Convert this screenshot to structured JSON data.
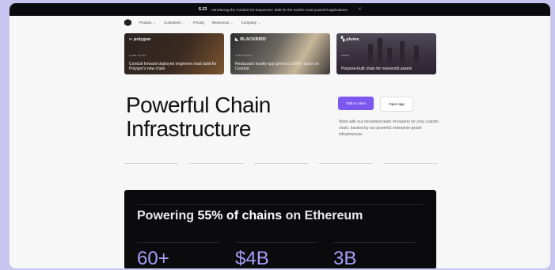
{
  "announcement": {
    "badge": "S-23",
    "text": "Introducing the Conduit G3 Sequencer: Built for the world's most powerful applications",
    "close": "×"
  },
  "nav": {
    "items": [
      {
        "label": "Product",
        "chevron": "⌄"
      },
      {
        "label": "Customers",
        "chevron": "⌄"
      },
      {
        "label": "Pricing",
        "chevron": ""
      },
      {
        "label": "Resources",
        "chevron": "⌄"
      },
      {
        "label": "Company",
        "chevron": "⌄"
      }
    ]
  },
  "cards": [
    {
      "brand": "polygon",
      "category": "CASE STUDY",
      "title": "Conduit forward-deployed engineers lead build for Polygon's new chain"
    },
    {
      "brand": "BLACKBIRD",
      "category": "CASE STUDY",
      "title": "Restaurant loyalty app grows to 100k+ users on Conduit"
    },
    {
      "brand": "plume",
      "category": "NEWS",
      "title": "Purpose-built chain for real-world assets"
    }
  ],
  "hero": {
    "title_line1": "Powerful Chain",
    "title_line2": "Infrastructure",
    "primary_cta": "Talk to sales",
    "secondary_cta": "Open app",
    "description": "Work with our renowned team of experts for your custom chain, backed by our powerful enterprise-grade infrastructure."
  },
  "stats_section": {
    "headline_pre": "Powering ",
    "headline_bold": "55% of chains",
    "headline_post": " on Ethereum",
    "stats": [
      "60+",
      "$4B",
      "3B"
    ]
  },
  "colors": {
    "accent": "#7c58f0",
    "stat_color": "#a89cf6",
    "frame_bg": "#c9c5f1"
  }
}
